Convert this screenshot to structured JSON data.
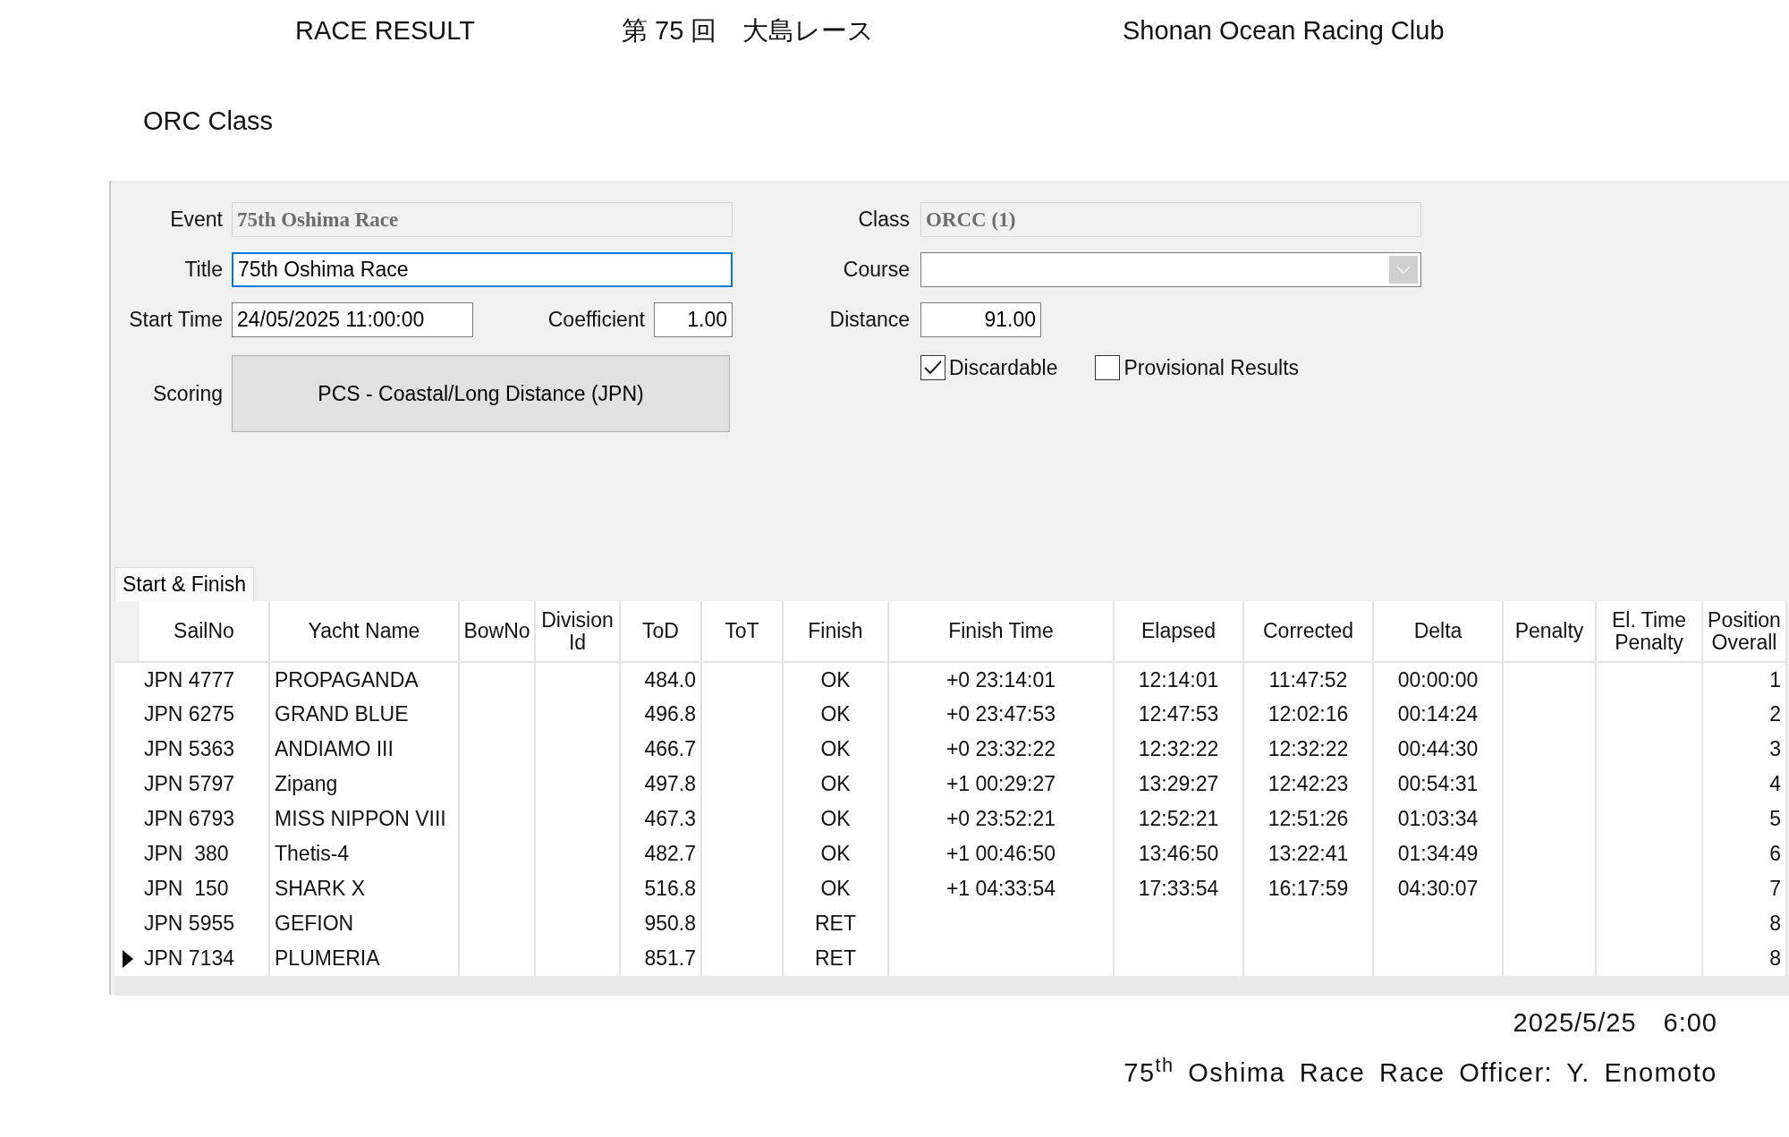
{
  "header": {
    "left": "RACE RESULT",
    "center": "第 75 回　大島レース",
    "right": "Shonan Ocean Racing Club"
  },
  "class_title": "ORC Class",
  "form": {
    "event": {
      "label": "Event",
      "value": "75th Oshima Race",
      "disabled": true
    },
    "title": {
      "label": "Title",
      "value": "75th Oshima Race",
      "focused": true
    },
    "start_time": {
      "label": "Start Time",
      "value": "24/05/2025 11:00:00"
    },
    "coefficient": {
      "label": "Coefficient",
      "value": "1.00"
    },
    "scoring": {
      "label": "Scoring",
      "value": "PCS - Coastal/Long Distance (JPN)"
    },
    "class": {
      "label": "Class",
      "value": "ORCC (1)",
      "disabled": true
    },
    "course": {
      "label": "Course"
    },
    "distance": {
      "label": "Distance",
      "value": "91.00"
    },
    "checkboxes": [
      {
        "label": "Discardable",
        "checked": true
      },
      {
        "label": "Provisional Results",
        "checked": false
      }
    ]
  },
  "tabs": [
    {
      "label": "Start & Finish",
      "selected": true
    }
  ],
  "table": {
    "columns": [
      "SailNo",
      "Yacht Name",
      "BowNo",
      "Division Id",
      "ToD",
      "ToT",
      "Finish",
      "Finish Time",
      "Elapsed",
      "Corrected",
      "Delta",
      "Penalty",
      "El. Time Penalty",
      "Position Overall"
    ],
    "rows": [
      {
        "sail_no": "JPN 4777",
        "yacht_name": "PROPAGANDA",
        "tod": "484.0",
        "finish": "OK",
        "finish_time": "+0 23:14:01",
        "elapsed": "12:14:01",
        "corrected": "11:47:52",
        "delta": "00:00:00",
        "position_overall": "1",
        "selected": false
      },
      {
        "sail_no": "JPN 6275",
        "yacht_name": "GRAND BLUE",
        "tod": "496.8",
        "finish": "OK",
        "finish_time": "+0 23:47:53",
        "elapsed": "12:47:53",
        "corrected": "12:02:16",
        "delta": "00:14:24",
        "position_overall": "2",
        "selected": false
      },
      {
        "sail_no": "JPN 5363",
        "yacht_name": "ANDIAMO III",
        "tod": "466.7",
        "finish": "OK",
        "finish_time": "+0 23:32:22",
        "elapsed": "12:32:22",
        "corrected": "12:32:22",
        "delta": "00:44:30",
        "position_overall": "3",
        "selected": false
      },
      {
        "sail_no": "JPN 5797",
        "yacht_name": "Zipang",
        "tod": "497.8",
        "finish": "OK",
        "finish_time": "+1 00:29:27",
        "elapsed": "13:29:27",
        "corrected": "12:42:23",
        "delta": "00:54:31",
        "position_overall": "4",
        "selected": false
      },
      {
        "sail_no": "JPN 6793",
        "yacht_name": "MISS NIPPON VIII",
        "tod": "467.3",
        "finish": "OK",
        "finish_time": "+0 23:52:21",
        "elapsed": "12:52:21",
        "corrected": "12:51:26",
        "delta": "01:03:34",
        "position_overall": "5",
        "selected": false
      },
      {
        "sail_no": "JPN  380",
        "yacht_name": "Thetis-4",
        "tod": "482.7",
        "finish": "OK",
        "finish_time": "+1 00:46:50",
        "elapsed": "13:46:50",
        "corrected": "13:22:41",
        "delta": "01:34:49",
        "position_overall": "6",
        "selected": false
      },
      {
        "sail_no": "JPN  150",
        "yacht_name": "SHARK X",
        "tod": "516.8",
        "finish": "OK",
        "finish_time": "+1 04:33:54",
        "elapsed": "17:33:54",
        "corrected": "16:17:59",
        "delta": "04:30:07",
        "position_overall": "7",
        "selected": false
      },
      {
        "sail_no": "JPN 5955",
        "yacht_name": "GEFION",
        "tod": "950.8",
        "finish": "RET",
        "position_overall": "8",
        "selected": false
      },
      {
        "sail_no": "JPN 7134",
        "yacht_name": "PLUMERIA",
        "tod": "851.7",
        "finish": "RET",
        "position_overall": "8",
        "selected": true
      }
    ]
  },
  "footer": {
    "date": "2025/5/25　6:00",
    "note": "75$^{th}$ Oshima Race Race Officer: Y. Enomoto"
  }
}
